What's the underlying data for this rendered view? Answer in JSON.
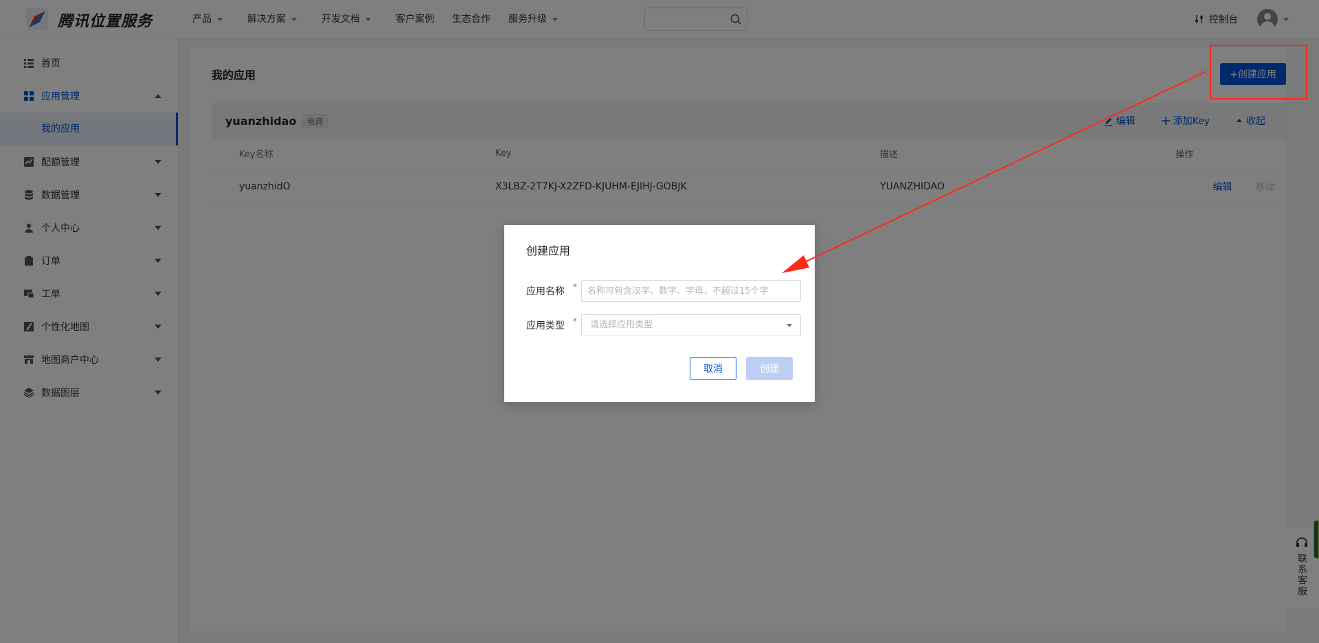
{
  "brand": {
    "name": "腾讯位置服务"
  },
  "nav": {
    "items": [
      {
        "label": "产品",
        "caret": true
      },
      {
        "label": "解决方案",
        "caret": true
      },
      {
        "label": "开发文档",
        "caret": true
      },
      {
        "label": "客户案例",
        "caret": false
      },
      {
        "label": "生态合作",
        "caret": false
      },
      {
        "label": "服务升级",
        "caret": true
      }
    ],
    "search_placeholder": "",
    "console_label": "控制台"
  },
  "sidebar": {
    "items": [
      {
        "label": "首页",
        "icon": "list-icon"
      },
      {
        "label": "应用管理",
        "icon": "grid-icon",
        "expanded": true,
        "sub": "我的应用"
      },
      {
        "label": "配额管理",
        "icon": "chart-icon"
      },
      {
        "label": "数据管理",
        "icon": "database-icon"
      },
      {
        "label": "个人中心",
        "icon": "user-icon"
      },
      {
        "label": "订单",
        "icon": "clipboard-icon"
      },
      {
        "label": "工单",
        "icon": "ticket-icon"
      },
      {
        "label": "个性化地图",
        "icon": "map-style-icon"
      },
      {
        "label": "地图商户中心",
        "icon": "store-icon"
      },
      {
        "label": "数据图层",
        "icon": "layers-icon"
      }
    ]
  },
  "main": {
    "title": "我的应用",
    "create_button": "+创建应用",
    "app": {
      "name": "yuanzhidao",
      "tag": "电商",
      "actions": {
        "edit": "编辑",
        "add_key": "添加Key",
        "collapse": "收起"
      },
      "columns": [
        "Key名称",
        "Key",
        "描述",
        "操作"
      ],
      "rows": [
        {
          "key_name": "yuanzhidO",
          "key": "X3LBZ-2T7KJ-X2ZFD-KJUHM-EJIHJ-GOBJK",
          "description": "YUANZHIDAO",
          "op_edit": "编辑",
          "op_move": "移动"
        }
      ]
    }
  },
  "modal": {
    "title": "创建应用",
    "name_label": "应用名称",
    "name_placeholder": "名称可包含汉字、数字、字母，不超过15个字",
    "name_value": "",
    "type_label": "应用类型",
    "type_placeholder": "请选择应用类型",
    "cancel": "取消",
    "create": "创建"
  },
  "contact": {
    "label": "联系客服"
  },
  "colors": {
    "accent": "#0052d9",
    "annotation": "#ff2a1a",
    "overlay": "rgba(0,0,0,0.5)"
  }
}
